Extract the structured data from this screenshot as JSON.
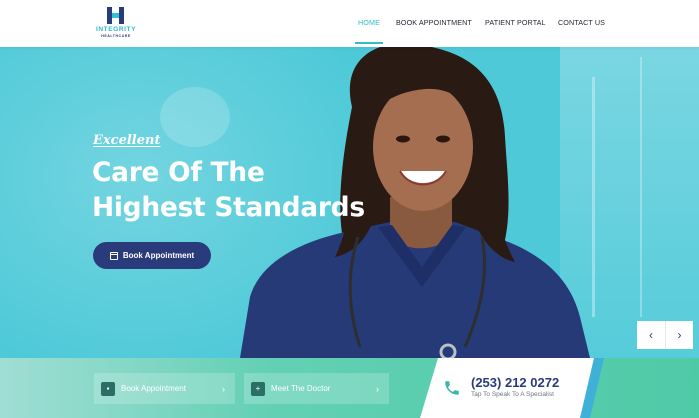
{
  "header": {
    "logo": {
      "brand": "INTEGRITY",
      "tagline": "HEALTHCARE"
    },
    "nav": [
      {
        "label": "HOME",
        "active": true
      },
      {
        "label": "BOOK APPOINTMENT",
        "active": false
      },
      {
        "label": "PATIENT PORTAL",
        "active": false
      },
      {
        "label": "CONTACT US",
        "active": false
      }
    ]
  },
  "hero": {
    "eyebrow": "Excellent",
    "title_line1": "Care Of The",
    "title_line2": "Highest Standards",
    "cta_label": "Book Appointment",
    "cta_icon": "calendar-icon",
    "prev_arrow": "‹",
    "next_arrow": "›"
  },
  "bottom": {
    "cards": [
      {
        "label": "Book Appointment",
        "icon": "contact-card-icon",
        "chevron": "›"
      },
      {
        "label": "Meet The Doctor",
        "icon": "medical-kit-icon",
        "chevron": "›"
      }
    ],
    "phone": {
      "number": "(253) 212 0272",
      "tagline": "Tap To Speak To A Specialist",
      "icon": "phone-icon"
    }
  },
  "colors": {
    "brand_navy": "#2a3b7c",
    "brand_teal": "#2fbdc9",
    "hero_bg": "#4dc9d8",
    "bottom_bg": "#4fcaa7"
  }
}
